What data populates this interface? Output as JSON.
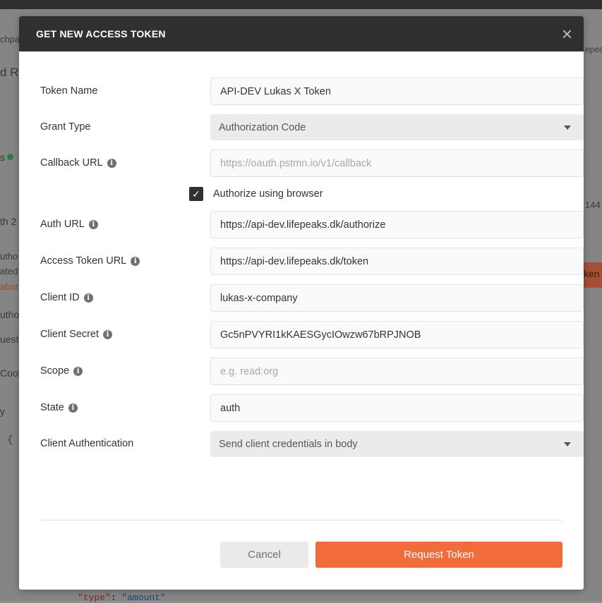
{
  "background": {
    "fragments": [
      "chpa",
      "d R",
      "s",
      "th 2",
      "utho",
      "ated",
      "abor",
      "utho",
      "uest",
      "Cool",
      "y",
      "{",
      "144",
      "ken",
      "epea"
    ],
    "code_line": {
      "key": "\"type\"",
      "sep": ": ",
      "value": "\"amount\""
    }
  },
  "modal": {
    "title": "GET NEW ACCESS TOKEN",
    "close_icon": "×",
    "fields": {
      "token_name": {
        "label": "Token Name",
        "value": "API-DEV Lukas X Token"
      },
      "grant_type": {
        "label": "Grant Type",
        "value": "Authorization Code"
      },
      "callback_url": {
        "label": "Callback URL",
        "placeholder": "https://oauth.pstmn.io/v1/callback"
      },
      "authorize_browser": {
        "label": "Authorize using browser",
        "checked": true
      },
      "auth_url": {
        "label": "Auth URL",
        "value": "https://api-dev.lifepeaks.dk/authorize"
      },
      "access_token_url": {
        "label": "Access Token URL",
        "value": "https://api-dev.lifepeaks.dk/token"
      },
      "client_id": {
        "label": "Client ID",
        "value": "lukas-x-company"
      },
      "client_secret": {
        "label": "Client Secret",
        "value": "Gc5nPVYRI1kKAESGycIOwzw67bRPJNOB"
      },
      "scope": {
        "label": "Scope",
        "placeholder": "e.g. read:org"
      },
      "state": {
        "label": "State",
        "value": "auth"
      },
      "client_auth": {
        "label": "Client Authentication",
        "value": "Send client credentials in body"
      }
    },
    "info_glyph": "i",
    "check_glyph": "✓",
    "buttons": {
      "cancel": "Cancel",
      "request": "Request Token"
    }
  },
  "colors": {
    "header_bg": "#303030",
    "accent": "#f26b3a",
    "checkbox": "#303030"
  }
}
